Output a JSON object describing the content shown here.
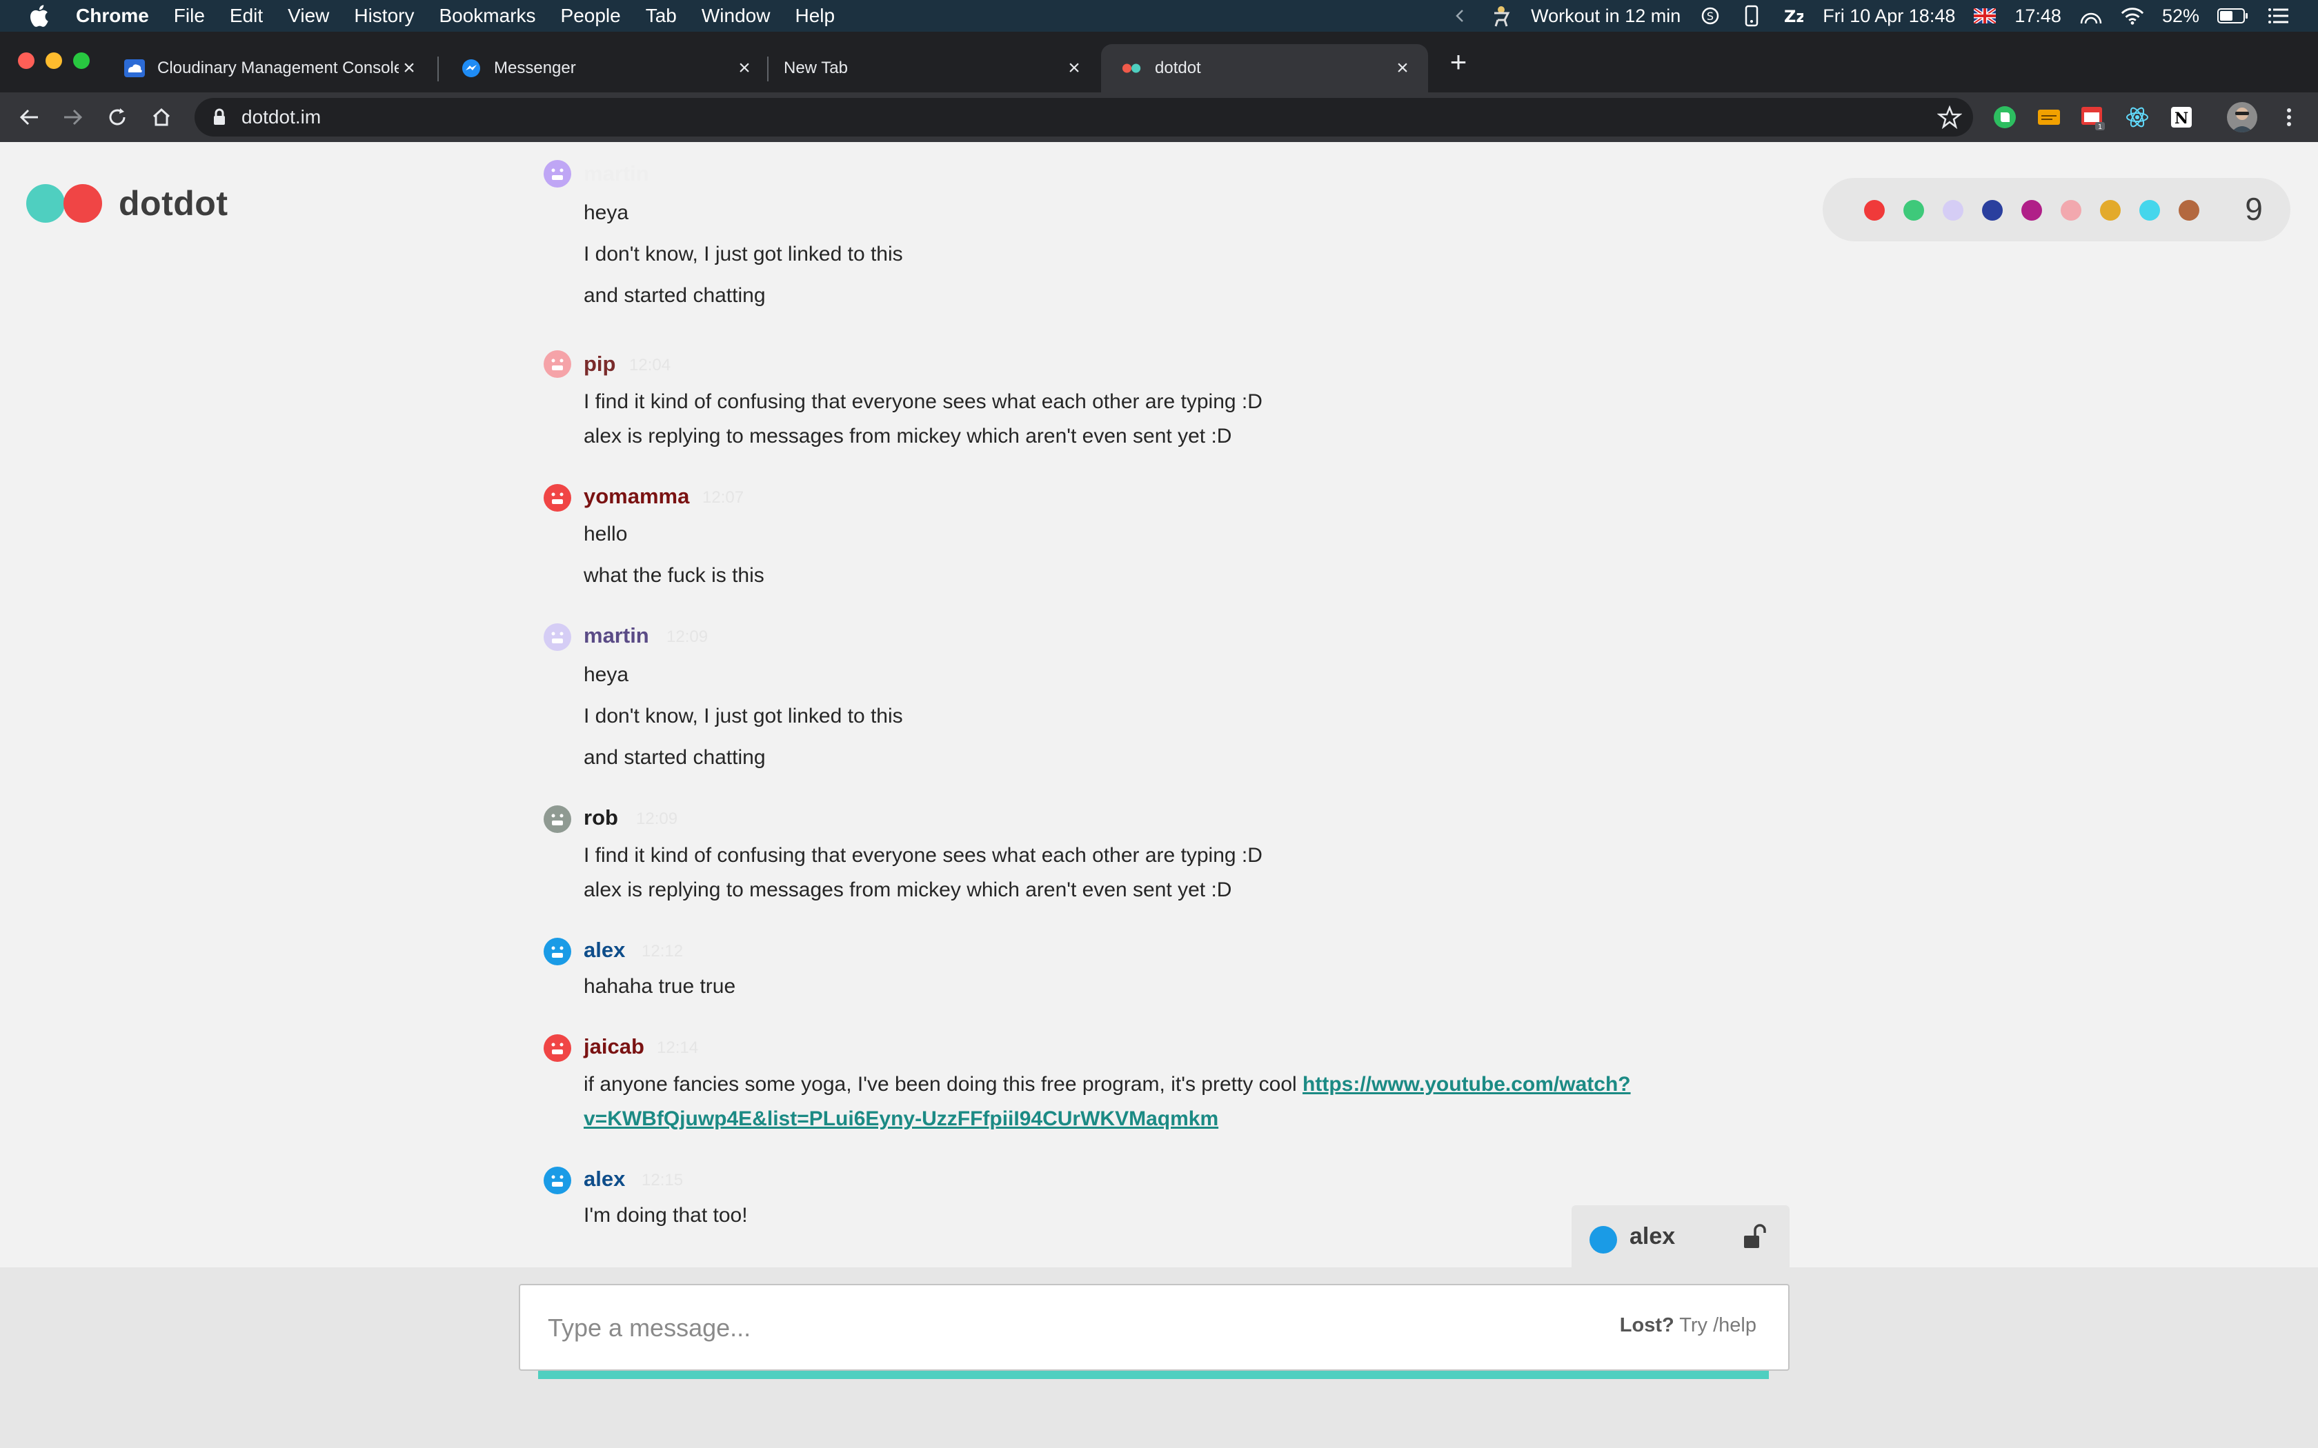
{
  "menubar": {
    "items": [
      "Chrome",
      "File",
      "Edit",
      "View",
      "History",
      "Bookmarks",
      "People",
      "Tab",
      "Window",
      "Help"
    ],
    "reminder": "Workout in 12 min",
    "date": "Fri 10 Apr  18:48",
    "time": "17:48",
    "battery": "52%"
  },
  "tabs": [
    {
      "title": "Cloudinary Management Console",
      "favicon": "cloudinary-icon"
    },
    {
      "title": "Messenger",
      "favicon": "messenger-icon"
    },
    {
      "title": "New Tab",
      "favicon": ""
    },
    {
      "title": "dotdot",
      "favicon": "dotdot-icon"
    }
  ],
  "omnibox": {
    "url": "dotdot.im"
  },
  "app": {
    "name": "dotdot",
    "online_count": "9",
    "user_colors": [
      "#f03a3a",
      "#3ec97a",
      "#d5cdf5",
      "#2a3f9e",
      "#b01f88",
      "#f2a8ae",
      "#e3aa2b",
      "#45d6ec",
      "#b3683f"
    ]
  },
  "messages": [
    {
      "user": "martin",
      "time": "",
      "color": "#efefef",
      "avatar": "#bfa6f5",
      "lines": [
        "heya",
        "I don't know, I just got linked to this",
        "and started chatting"
      ]
    },
    {
      "user": "pip",
      "time": "12:04",
      "color": "#7a2b2b",
      "avatar": "#f5a3a8",
      "lines": [
        "I find it kind of confusing that everyone sees what each other are typing :D",
        "alex is replying to messages from mickey which aren't even sent yet :D"
      ]
    },
    {
      "user": "yomamma",
      "time": "12:07",
      "color": "#7a1212",
      "avatar": "#f04545",
      "lines": [
        "hello",
        "what the fuck is this"
      ]
    },
    {
      "user": "martin",
      "time": "12:09",
      "color": "#5a4b86",
      "avatar": "#d5cdf5",
      "lines": [
        "heya",
        "I don't know, I just got linked to this",
        "and started chatting"
      ]
    },
    {
      "user": "rob",
      "time": "12:09",
      "color": "#1e1e1e",
      "avatar": "#8f9a92",
      "lines": [
        "I find it kind of confusing that everyone sees what each other are typing :D",
        "alex is replying to messages from mickey which aren't even sent yet :D"
      ]
    },
    {
      "user": "alex",
      "time": "12:12",
      "color": "#0e4d8a",
      "avatar": "#1a9be6",
      "lines": [
        "hahaha true true"
      ]
    },
    {
      "user": "jaicab",
      "time": "12:14",
      "color": "#7a1212",
      "avatar": "#f04545",
      "lines": [
        "if anyone fancies some yoga, I've been doing this free program, it's pretty cool "
      ],
      "link": [
        "https://www.youtube.com/watch?",
        "v=KWBfQjuwp4E&list=PLui6Eyny-UzzFFfpiiI94CUrWKVMaqmkm"
      ]
    },
    {
      "user": "alex",
      "time": "12:15",
      "color": "#0e4d8a",
      "avatar": "#1a9be6",
      "lines": [
        "I'm doing that too!"
      ]
    }
  ],
  "current_user": {
    "name": "alex"
  },
  "composer": {
    "placeholder": "Type a message...",
    "help_bold": "Lost?",
    "help_text": " Try /help"
  }
}
